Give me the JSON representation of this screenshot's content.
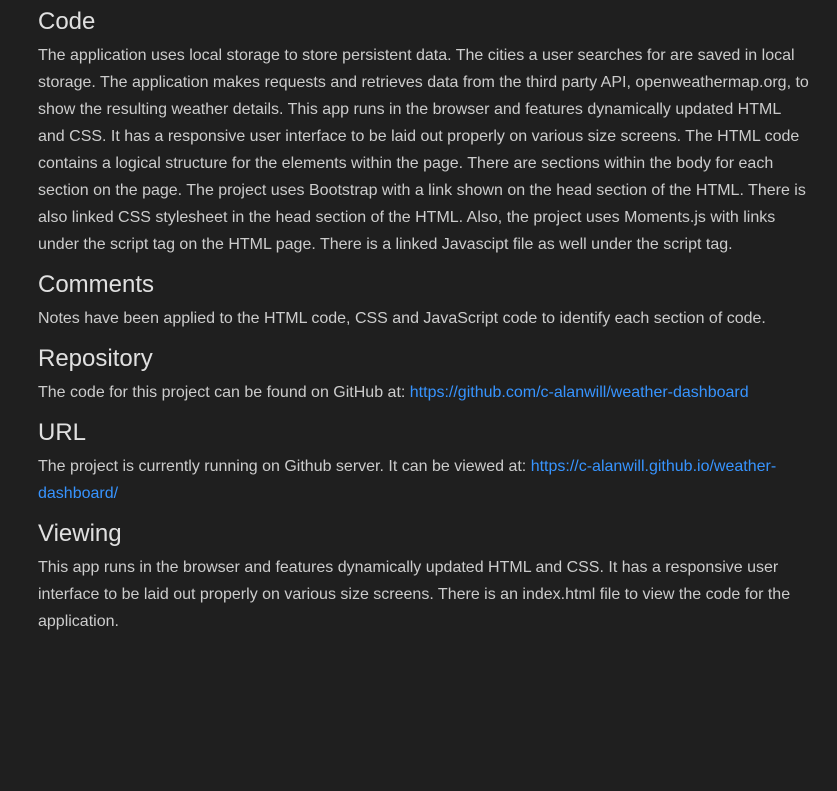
{
  "sections": {
    "code": {
      "heading": "Code",
      "body": "The application uses local storage to store persistent data. The cities a user searches for are saved in local storage. The application makes requests and retrieves data from the third party API, openweathermap.org, to show the resulting weather details. This app runs in the browser and features dynamically updated HTML and CSS. It has a responsive user interface to be laid out properly on various size screens. The HTML code contains a logical structure for the elements within the page. There are sections within the body for each section on the page. The project uses Bootstrap with a link shown on the head section of the HTML. There is also linked CSS stylesheet in the head section of the HTML. Also, the project uses Moments.js with links under the script tag on the HTML page. There is a linked Javascipt file as well under the script tag."
    },
    "comments": {
      "heading": "Comments",
      "body": "Notes have been applied to the HTML code, CSS and JavaScript code to identify each section of code."
    },
    "repository": {
      "heading": "Repository",
      "body": "The code for this project can be found on GitHub at: ",
      "link": "https://github.com/c-alanwill/weather-dashboard"
    },
    "url": {
      "heading": "URL",
      "body": "The project is currently running on Github server. It can be viewed at: ",
      "link": "https://c-alanwill.github.io/weather-dashboard/"
    },
    "viewing": {
      "heading": "Viewing",
      "body": "This app runs in the browser and features dynamically updated HTML and CSS. It has a responsive user interface to be laid out properly on various size screens. There is an index.html file to view the code for the application."
    }
  },
  "colors": {
    "background": "#1f1f1f",
    "text": "#cccccc",
    "heading": "#e0e0e0",
    "link": "#3794ff"
  }
}
